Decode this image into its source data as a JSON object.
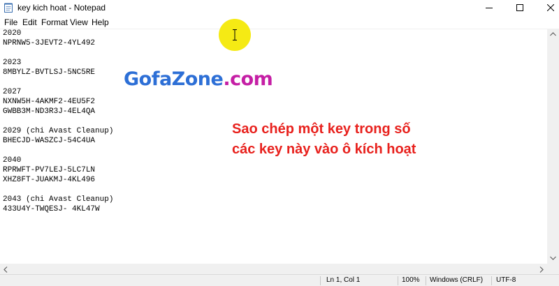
{
  "window": {
    "title": "key kich hoat - Notepad"
  },
  "menu": {
    "file": "File",
    "edit": "Edit",
    "format": "Format",
    "view": "View",
    "help": "Help"
  },
  "editor": {
    "lines": [
      "2020",
      "NPRNW5-3JEVT2-4YL492",
      "",
      "2023",
      "8MBYLZ-BVTLSJ-5NC5RE",
      "",
      "2027",
      "NXNW5H-4AKMF2-4EU5F2",
      "GWBB3M-ND3R3J-4EL4QA",
      "",
      "2029 (chi Avast Cleanup)",
      "BHECJD-WASZCJ-54C4UA",
      "",
      "2040",
      "RPRWFT-PV7LEJ-5LC7LN",
      "XHZ8FT-JUAKMJ-4KL496",
      "",
      "2043 (chi Avast Cleanup)",
      "433U4Y-TWQESJ- 4KL47W"
    ]
  },
  "status": {
    "position": "Ln 1, Col 1",
    "zoom": "100%",
    "line_ending": "Windows (CRLF)",
    "encoding": "UTF-8"
  },
  "watermark": {
    "part1": "GofaZone",
    "part2": ".com",
    "color1": "#2d6fd6",
    "color2": "#c51fa5"
  },
  "annotation": {
    "line1": "Sao chép một key trong số",
    "line2": "các key này vào ô kích hoạt",
    "color": "#e8211d"
  },
  "colors": {
    "cursor_highlight": "#f5ea14"
  }
}
